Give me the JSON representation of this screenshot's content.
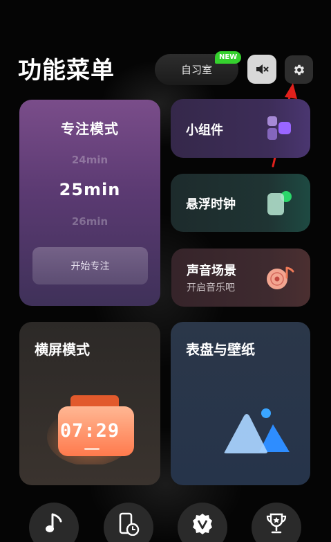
{
  "header": {
    "title": "功能菜单",
    "study_room_label": "自习室",
    "new_badge": "NEW"
  },
  "focus_mode": {
    "title": "专注模式",
    "time_prev": "24min",
    "time_current": "25min",
    "time_next": "26min",
    "start_label": "开始专注"
  },
  "cards": {
    "widgets": {
      "title": "小组件"
    },
    "floating_clock": {
      "title": "悬浮时钟"
    },
    "sound_scene": {
      "title": "声音场景",
      "subtitle": "开启音乐吧"
    },
    "landscape": {
      "title": "横屏模式",
      "clock_display": "07:29"
    },
    "dial_wallpaper": {
      "title": "表盘与壁纸"
    }
  },
  "dock": {
    "icons": [
      "music-note-icon",
      "phone-clock-icon",
      "v-badge-icon",
      "trophy-icon"
    ]
  },
  "colors": {
    "new_badge": "#35d12e",
    "annotation_arrow": "#e0201c",
    "focus_card": "#6b4580"
  }
}
